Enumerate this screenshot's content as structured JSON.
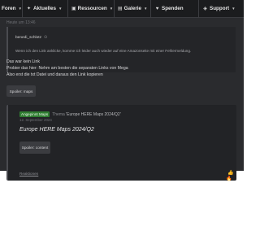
{
  "nav": {
    "items": [
      {
        "label": "Foren",
        "icon": "",
        "has_chevron": true
      },
      {
        "label": "Aktuelles",
        "icon": "sparkle-icon",
        "has_chevron": true
      },
      {
        "label": "Ressourcen",
        "icon": "box-icon",
        "has_chevron": true
      },
      {
        "label": "Galerie",
        "icon": "gallery-icon",
        "has_chevron": true
      },
      {
        "label": "Spenden",
        "icon": "donate-icon",
        "has_chevron": false
      },
      {
        "label": "Support",
        "icon": "tag-icon",
        "has_chevron": true
      }
    ]
  },
  "post": {
    "timestamp": "Heute um 13:46",
    "quote": {
      "author": "benedi_schlotz",
      "text": "Wenn ich den Link anklicke, komme ich leider auch wieder auf eine Amazonseite mit einer Fehlermeldung."
    },
    "lines": [
      "Das war kein Link",
      "Probier das hier: Nehm am besten die separaten Links von Mega",
      "Also erst die txt Datei und daraus den Link kopieren"
    ],
    "spoiler_button": "Spoiler: maps",
    "embedded": {
      "badge": "Angepinnt Maps",
      "prefix": "Thema",
      "title": "'Europe HERE Maps 2024/Q2'",
      "date": "12. September 2024",
      "heading": "Europe HERE Maps 2024/Q2",
      "spoiler_button": "Spoiler: content",
      "reactions_link": "Reaktionen"
    }
  },
  "colors": {
    "background": "#2a2b2e",
    "nav_background": "#1b1c1e",
    "badge": "#2f7d31"
  }
}
